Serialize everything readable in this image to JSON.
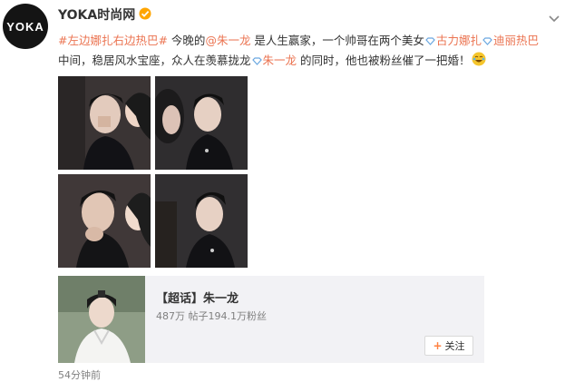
{
  "author": {
    "name": "YOKA时尚网",
    "avatar_text": "YOKA"
  },
  "icons": {
    "verified": "verified-badge-icon",
    "more": "chevron-down-icon",
    "diamond": "diamond-icon",
    "emoji": "laugh-emoji-icon"
  },
  "post": {
    "hashtag": "#左边娜扎右边热巴#",
    "t1": " 今晚的",
    "mention": "@朱一龙",
    "t2": " 是人生赢家，一个帅哥在两个美女",
    "link1": "古力娜扎",
    "link2": "迪丽热巴",
    "t3": " 中间，稳居风水宝座，众人在羡慕拢龙",
    "link3": "朱一龙",
    "t4": " 的同时，他也被粉丝催了一把婚！"
  },
  "card": {
    "title": "【超话】朱一龙",
    "stats": "487万 帖子194.1万粉丝",
    "follow_label": "关注"
  },
  "timestamp": "54分钟前",
  "colors": {
    "link": "#eb7350",
    "verify": "#ffa500",
    "card_bg": "#f2f2f5"
  }
}
